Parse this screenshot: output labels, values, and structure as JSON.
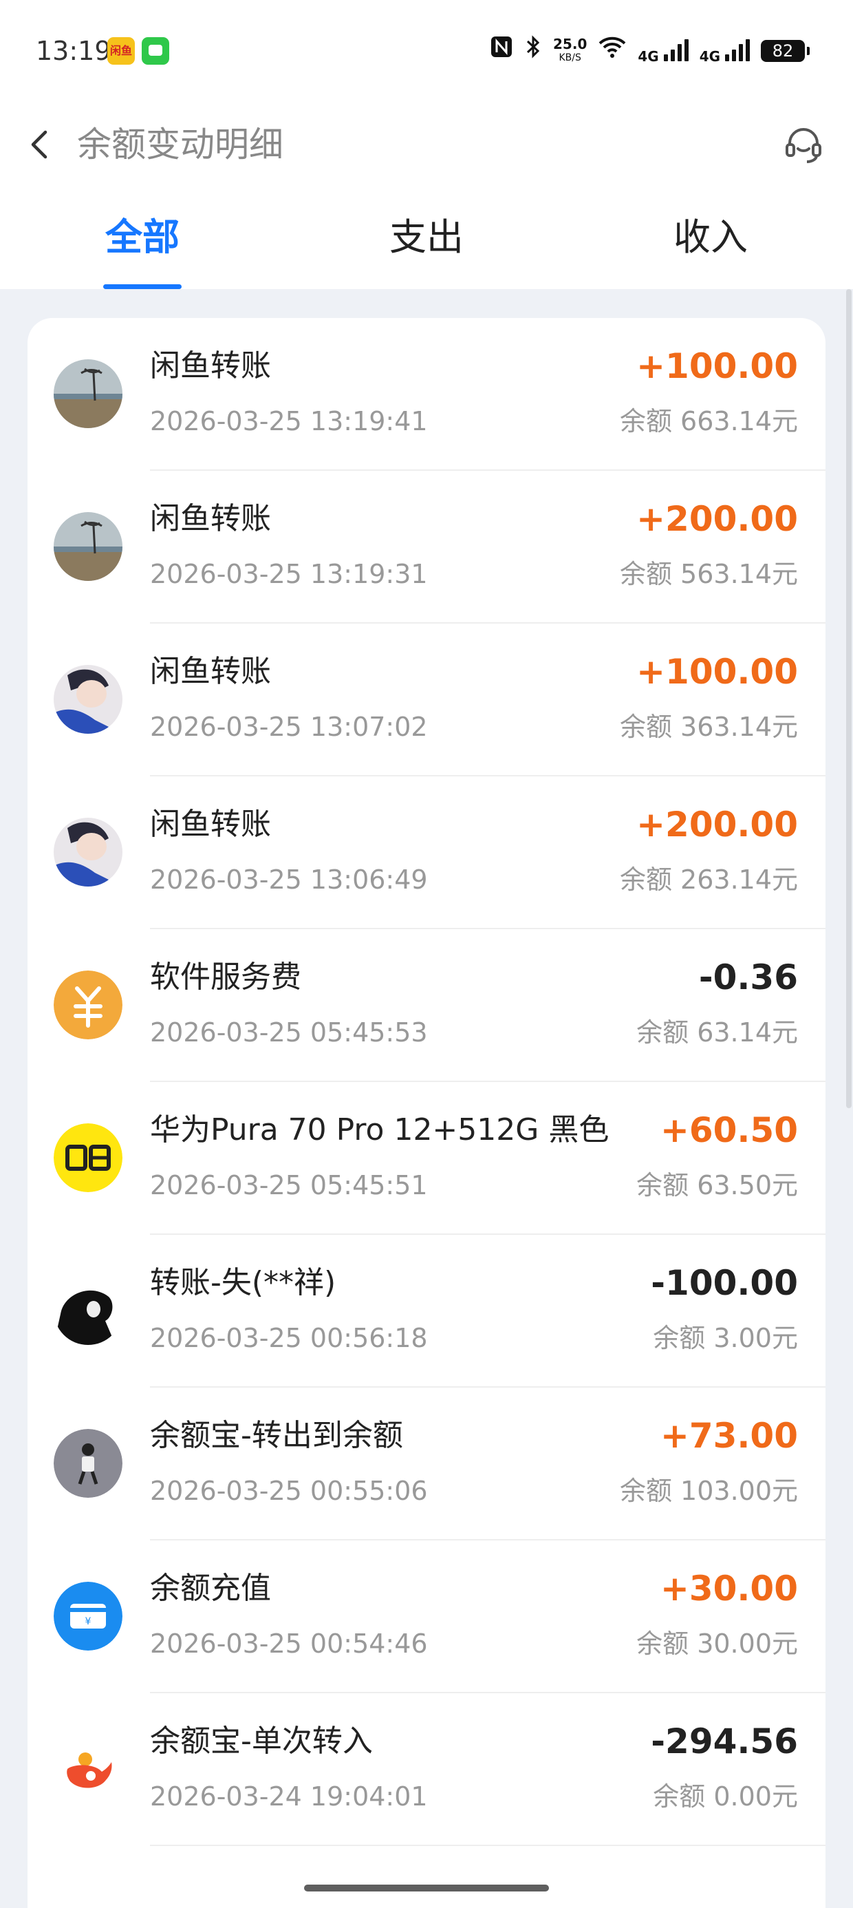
{
  "status_bar": {
    "time": "13:19",
    "app_icon_a_label": "闲鱼",
    "net_speed_value": "25.0",
    "net_speed_unit": "KB/S",
    "signal1_label": "4G",
    "signal2_label": "4G",
    "battery": "82"
  },
  "header": {
    "title": "余额变动明细",
    "back_icon": "chevron-left-icon",
    "service_icon": "headset-icon"
  },
  "tabs": [
    {
      "label": "全部",
      "active": true
    },
    {
      "label": "支出",
      "active": false
    },
    {
      "label": "收入",
      "active": false
    }
  ],
  "colors": {
    "accent": "#1677ff",
    "income": "#f06a19",
    "expense": "#222222"
  },
  "transactions": [
    {
      "title": "闲鱼转账",
      "time": "2026-03-25 13:19:41",
      "amount": "+100.00",
      "balance": "余额 663.14元",
      "type": "in",
      "avatar": "beach-avatar"
    },
    {
      "title": "闲鱼转账",
      "time": "2026-03-25 13:19:31",
      "amount": "+200.00",
      "balance": "余额 563.14元",
      "type": "in",
      "avatar": "beach-avatar"
    },
    {
      "title": "闲鱼转账",
      "time": "2026-03-25 13:07:02",
      "amount": "+100.00",
      "balance": "余额 363.14元",
      "type": "in",
      "avatar": "anime-avatar"
    },
    {
      "title": "闲鱼转账",
      "time": "2026-03-25 13:06:49",
      "amount": "+200.00",
      "balance": "余额 263.14元",
      "type": "in",
      "avatar": "anime-avatar"
    },
    {
      "title": "软件服务费",
      "time": "2026-03-25 05:45:53",
      "amount": "-0.36",
      "balance": "余额 63.14元",
      "type": "out",
      "avatar": "yuan-icon"
    },
    {
      "title": "华为Pura 70 Pro 12+512G 黑色",
      "time": "2026-03-25 05:45:51",
      "amount": "+60.50",
      "balance": "余额 63.50元",
      "type": "in",
      "avatar": "xianyu-logo"
    },
    {
      "title": "转账-失(**祥)",
      "time": "2026-03-25 00:56:18",
      "amount": "-100.00",
      "balance": "余额 3.00元",
      "type": "out",
      "avatar": "dark-avatar"
    },
    {
      "title": "余额宝-转出到余额",
      "time": "2026-03-25 00:55:06",
      "amount": "+73.00",
      "balance": "余额 103.00元",
      "type": "in",
      "avatar": "person-avatar"
    },
    {
      "title": "余额充值",
      "time": "2026-03-25 00:54:46",
      "amount": "+30.00",
      "balance": "余额 30.00元",
      "type": "in",
      "avatar": "card-icon"
    },
    {
      "title": "余额宝-单次转入",
      "time": "2026-03-24 19:04:01",
      "amount": "-294.56",
      "balance": "余额 0.00元",
      "type": "out",
      "avatar": "yuebao-icon"
    }
  ]
}
